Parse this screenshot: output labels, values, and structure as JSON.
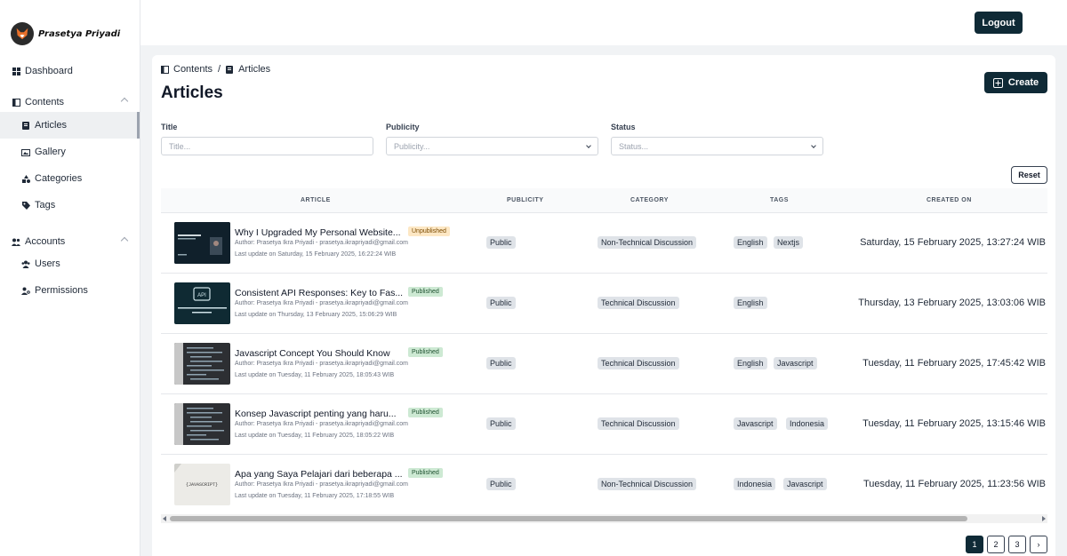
{
  "sidebar": {
    "brand_name": "Prasetya Priyadi",
    "items": {
      "dashboard": "Dashboard",
      "contents": "Contents",
      "articles": "Articles",
      "gallery": "Gallery",
      "categories": "Categories",
      "tags": "Tags",
      "accounts": "Accounts",
      "users": "Users",
      "permissions": "Permissions"
    }
  },
  "topbar": {
    "logout_label": "Logout"
  },
  "breadcrumb": {
    "root": "Contents",
    "separator": "/",
    "current": "Articles"
  },
  "page": {
    "title": "Articles",
    "create_label": "Create"
  },
  "filters": {
    "title_label": "Title",
    "title_placeholder": "Title...",
    "publicity_label": "Publicity",
    "publicity_placeholder": "Publicity...",
    "status_label": "Status",
    "status_placeholder": "Status...",
    "reset_label": "Reset"
  },
  "table": {
    "headers": [
      "ARTICLE",
      "PUBLICITY",
      "CATEGORY",
      "TAGS",
      "CREATED ON"
    ],
    "rows": [
      {
        "title": "Why I Upgraded My Personal Website...",
        "status": "Unpublished",
        "author": "Author: Prasetya Ikra Priyadi - prasetya.ikrapriyadi@gmail.com",
        "updated": "Last update on Saturday, 15 February 2025, 16:22:24 WIB",
        "publicity": "Public",
        "category": "Non-Technical Discussion",
        "tags": [
          "English",
          "Nextjs"
        ],
        "created": "Saturday, 15 February 2025, 13:27:24 WIB"
      },
      {
        "title": "Consistent API Responses: Key to Fas...",
        "status": "Published",
        "author": "Author: Prasetya Ikra Priyadi - prasetya.ikrapriyadi@gmail.com",
        "updated": "Last update on Thursday, 13 February 2025, 15:06:29 WIB",
        "publicity": "Public",
        "category": "Technical Discussion",
        "tags": [
          "English"
        ],
        "created": "Thursday, 13 February 2025, 13:03:06 WIB"
      },
      {
        "title": "Javascript Concept You Should Know",
        "status": "Published",
        "author": "Author: Prasetya Ikra Priyadi - prasetya.ikrapriyadi@gmail.com",
        "updated": "Last update on Tuesday, 11 February 2025, 18:05:43 WIB",
        "publicity": "Public",
        "category": "Technical Discussion",
        "tags": [
          "English",
          "Javascript"
        ],
        "created": "Tuesday, 11 February 2025, 17:45:42 WIB"
      },
      {
        "title": "Konsep Javascript penting yang haru...",
        "status": "Published",
        "author": "Author: Prasetya Ikra Priyadi - prasetya.ikrapriyadi@gmail.com",
        "updated": "Last update on Tuesday, 11 February 2025, 18:05:22 WIB",
        "publicity": "Public",
        "category": "Technical Discussion",
        "tags": [
          "Javascript",
          "Indonesia"
        ],
        "created": "Tuesday, 11 February 2025, 13:15:46 WIB"
      },
      {
        "title": "Apa yang Saya Pelajari dari beberapa ...",
        "status": "Published",
        "author": "Author: Prasetya Ikra Priyadi - prasetya.ikrapriyadi@gmail.com",
        "updated": "Last update on Tuesday, 11 February 2025, 17:18:55 WIB",
        "publicity": "Public",
        "category": "Non-Technical Discussion",
        "tags": [
          "Indonesia",
          "Javascript"
        ],
        "created": "Tuesday, 11 February 2025, 11:23:56 WIB"
      }
    ]
  },
  "pagination": {
    "pages": [
      "1",
      "2",
      "3"
    ],
    "next": "›",
    "current": "1"
  },
  "colors": {
    "primary": "#0f2a36",
    "published_bg": "#cde9d3",
    "unpublished_bg": "#fde7c4",
    "chip_bg": "#dfe3e8"
  }
}
